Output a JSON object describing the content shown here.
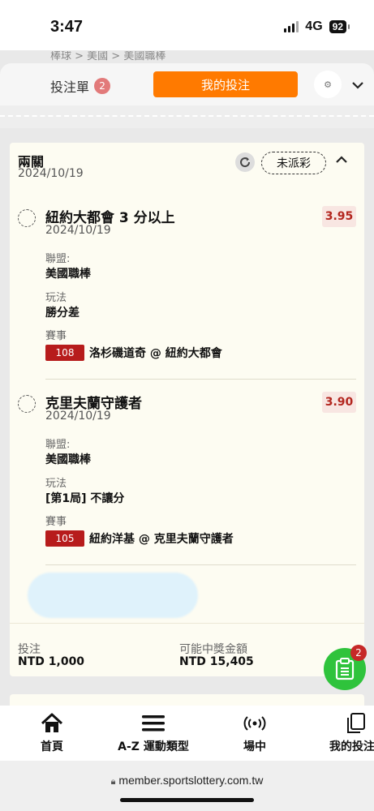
{
  "status_bar": {
    "time": "3:47",
    "network": "4G",
    "battery": "92"
  },
  "breadcrumb": "棒球 > 美國 > 美國職棒",
  "bet_bar": {
    "slip_label": "投注單",
    "slip_count": "2",
    "my_bets_label": "我的投注"
  },
  "bet": {
    "type": "兩關",
    "date": "2024/10/19",
    "status": "未派彩",
    "legs": [
      {
        "selection": "紐約大都會 3 分以上",
        "date": "2024/10/19",
        "odds": "3.95",
        "league_label": "聯盟:",
        "league": "美國職棒",
        "market_label": "玩法",
        "market": "勝分差",
        "event_label": "賽事",
        "event_id": "108",
        "event_name": "洛杉磯道奇 @ 紐約大都會"
      },
      {
        "selection": "克里夫蘭守護者",
        "date": "2024/10/19",
        "odds": "3.90",
        "league_label": "聯盟:",
        "league": "美國職棒",
        "market_label": "玩法",
        "market": "[第1局] 不讓分",
        "event_label": "賽事",
        "event_id": "105",
        "event_name": "紐約洋基 @ 克里夫蘭守護者"
      }
    ],
    "stake_label": "投注",
    "stake": "NTD 1,000",
    "payout_label": "可能中獎金額",
    "payout": "NTD 15,405"
  },
  "fab_badge": "2",
  "nav": [
    {
      "label": "首頁",
      "icon": "home-icon"
    },
    {
      "label": "A-Z 運動類型",
      "icon": "menu-icon"
    },
    {
      "label": "場中",
      "icon": "live-icon"
    },
    {
      "label": "我的投注",
      "icon": "my-bets-icon"
    }
  ],
  "address_bar": {
    "url": "member.sportslottery.com.tw"
  },
  "colors": {
    "accent": "#ff7a00",
    "odds": "#b3261e",
    "fab": "#2fc33c",
    "event_badge": "#b71c1c"
  }
}
